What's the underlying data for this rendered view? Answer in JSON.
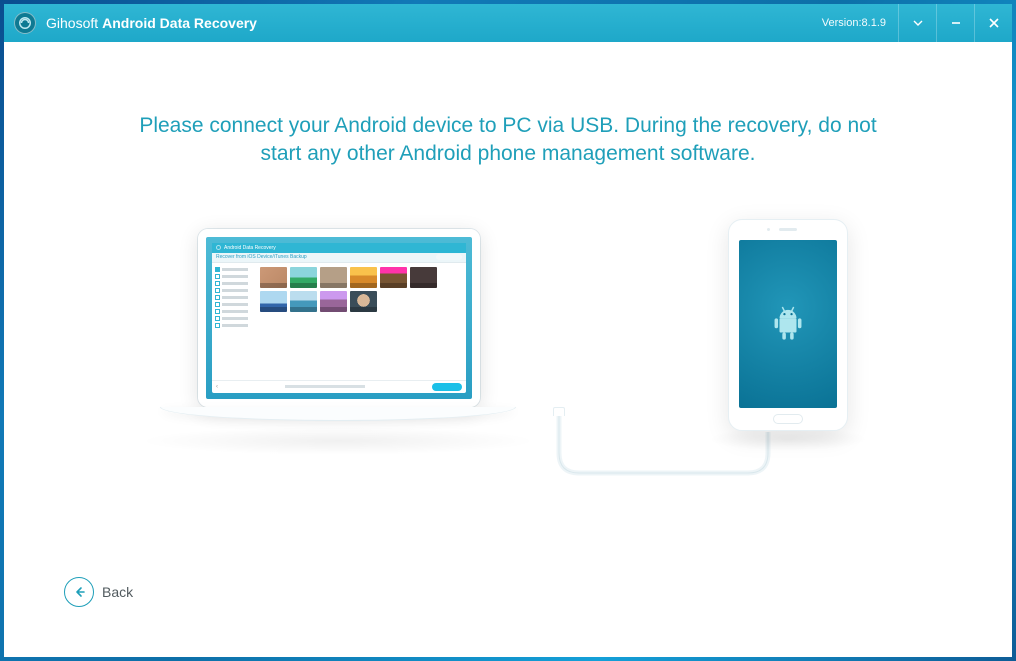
{
  "titlebar": {
    "brand": "Gihosoft",
    "product": "Android Data Recovery",
    "version": "Version:8.1.9"
  },
  "instruction": "Please connect your Android device to PC via USB. During the recovery, do not start any other Android phone management software.",
  "mini_app": {
    "title": "Android Data Recovery",
    "subtitle": "Recover from iOS Device/iTunes Backup"
  },
  "footer": {
    "back": "Back"
  }
}
